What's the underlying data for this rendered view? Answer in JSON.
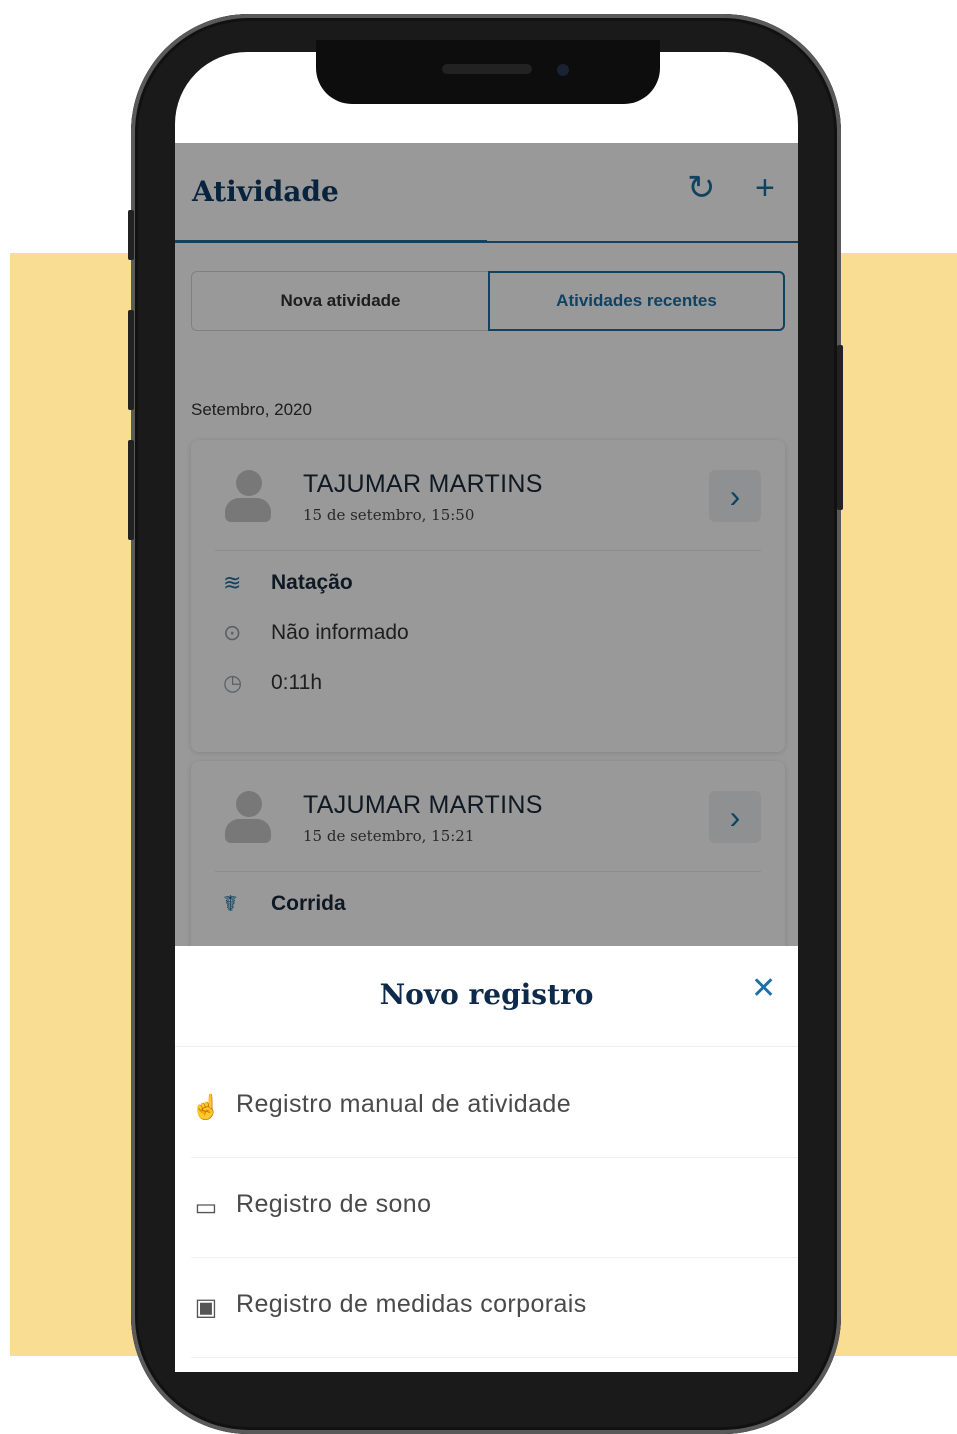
{
  "header": {
    "title": "Atividade",
    "refresh_icon": "refresh-icon",
    "add_icon": "plus-icon"
  },
  "tabs": [
    {
      "label": "Nova atividade",
      "active": false
    },
    {
      "label": "Atividades recentes",
      "active": true
    }
  ],
  "month_label": "Setembro, 2020",
  "activities": [
    {
      "name": "TAJUMAR MARTINS",
      "date": "15 de setembro, 15:50",
      "sport": "Natação",
      "sport_icon": "swimming-icon",
      "location": "Não informado",
      "duration": "0:11h"
    },
    {
      "name": "TAJUMAR MARTINS",
      "date": "15 de setembro, 15:21",
      "sport": "Corrida",
      "sport_icon": "running-icon"
    }
  ],
  "sheet": {
    "title": "Novo registro",
    "options": [
      {
        "label": "Registro manual de atividade",
        "icon": "hand-pointer-icon"
      },
      {
        "label": "Registro de sono",
        "icon": "bed-icon"
      },
      {
        "label": "Registro de medidas corporais",
        "icon": "scale-icon"
      }
    ]
  },
  "colors": {
    "background_accent": "#f9dd93",
    "primary": "#1c6fa3",
    "title_dark": "#0d3b66"
  }
}
